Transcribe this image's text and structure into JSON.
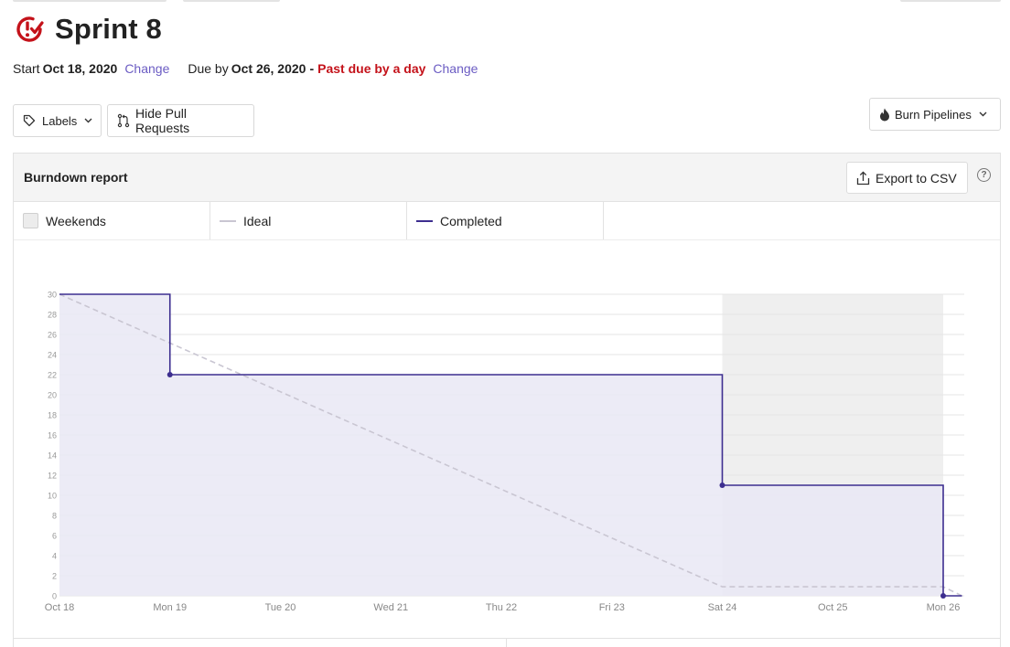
{
  "milestone": {
    "title": "Sprint 8",
    "start_label": "Start",
    "start_date": "Oct 18, 2020",
    "change_label": "Change",
    "due_label": "Due by",
    "due_date": "Oct 26, 2020",
    "separator": "-",
    "past_due_text": "Past due by a day",
    "change_label_2": "Change"
  },
  "toolbar": {
    "labels_button": "Labels",
    "hide_pr_button": "Hide Pull Requests",
    "burn_pipelines_button": "Burn Pipelines"
  },
  "report": {
    "title": "Burndown report",
    "export_button": "Export to CSV",
    "help_glyph": "?",
    "legend": {
      "weekends": "Weekends",
      "ideal": "Ideal",
      "completed": "Completed"
    }
  },
  "colors": {
    "past_due": "#c4121a",
    "link": "#6b5cc3",
    "completed_line": "#3d2e8f",
    "completed_fill": "#e9e7f5",
    "ideal_line": "#c9c6d2",
    "weekend_band": "#efefef"
  },
  "chart_data": {
    "type": "line",
    "title": "",
    "xlabel": "",
    "ylabel": "",
    "ylim": [
      0,
      30
    ],
    "yticks": [
      0,
      2,
      4,
      6,
      8,
      10,
      12,
      14,
      16,
      18,
      20,
      22,
      24,
      26,
      28,
      30
    ],
    "categories": [
      "Oct 18",
      "Mon 19",
      "Tue 20",
      "Wed 21",
      "Thu 22",
      "Fri 23",
      "Sat 24",
      "Oct 25",
      "Mon 26"
    ],
    "weekend_span": [
      "Sat 24",
      "Mon 26"
    ],
    "grid": true,
    "series": [
      {
        "name": "Completed",
        "style": "step",
        "points": [
          {
            "x": 0,
            "y": 30
          },
          {
            "x": 1,
            "y": 30
          },
          {
            "x": 1,
            "y": 22
          },
          {
            "x": 6,
            "y": 22
          },
          {
            "x": 6,
            "y": 11
          },
          {
            "x": 8,
            "y": 11
          },
          {
            "x": 8,
            "y": 0
          },
          {
            "x": 8.17,
            "y": 0
          }
        ],
        "markers": [
          {
            "x": 1,
            "y": 22
          },
          {
            "x": 6,
            "y": 11
          },
          {
            "x": 8,
            "y": 0
          }
        ]
      },
      {
        "name": "Ideal",
        "style": "dashed",
        "points": [
          {
            "x": 0,
            "y": 30
          },
          {
            "x": 6,
            "y": 0.9
          },
          {
            "x": 8,
            "y": 0.9
          },
          {
            "x": 8.17,
            "y": 0
          }
        ]
      }
    ]
  }
}
